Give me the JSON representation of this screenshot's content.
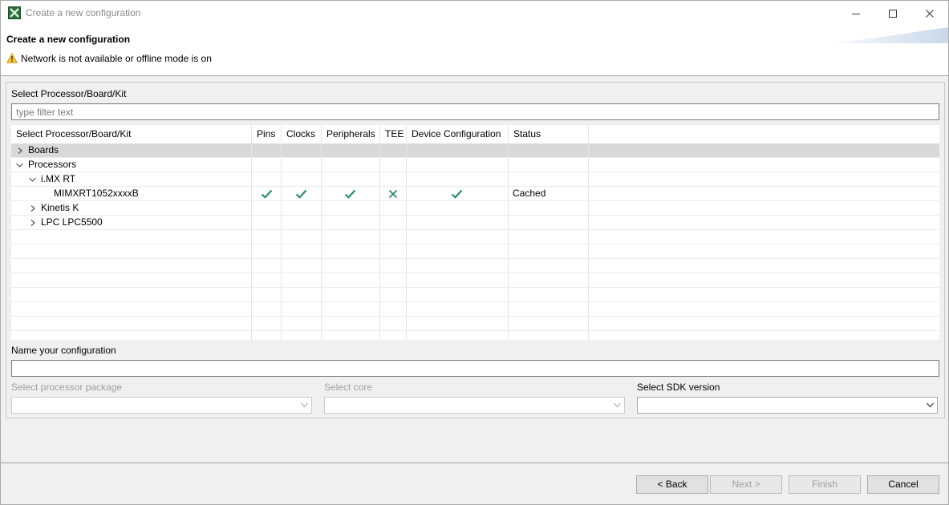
{
  "window": {
    "title": "Create a new configuration"
  },
  "header": {
    "title": "Create a new configuration",
    "message": "Network is not available or offline mode is on"
  },
  "selector": {
    "label": "Select Processor/Board/Kit",
    "filter_placeholder": "type filter text",
    "columns": [
      "Select Processor/Board/Kit",
      "Pins",
      "Clocks",
      "Peripherals",
      "TEE",
      "Device Configuration",
      "Status"
    ],
    "rows": [
      {
        "label": "Boards",
        "level": 0,
        "expander": "collapsed"
      },
      {
        "label": "Processors",
        "level": 0,
        "expander": "expanded"
      },
      {
        "label": "i.MX RT",
        "level": 1,
        "expander": "expanded"
      },
      {
        "label": "MIMXRT1052xxxxB",
        "level": 2,
        "expander": "none",
        "pins": "check",
        "clocks": "check",
        "peripherals": "check",
        "tee": "cross",
        "device_configuration": "check",
        "status": "Cached"
      },
      {
        "label": "Kinetis K",
        "level": 1,
        "expander": "collapsed"
      },
      {
        "label": "LPC LPC5500",
        "level": 1,
        "expander": "collapsed"
      }
    ]
  },
  "name_config": {
    "label": "Name your configuration",
    "value": ""
  },
  "package": {
    "label": "Select processor package",
    "value": ""
  },
  "core": {
    "label": "Select core",
    "value": ""
  },
  "sdk": {
    "label": "Select SDK version",
    "value": ""
  },
  "buttons": {
    "back": "< Back",
    "next": "Next >",
    "finish": "Finish",
    "cancel": "Cancel"
  },
  "colors": {
    "check": "#2f8a69",
    "cross": "#2f8a69",
    "selected_row": "#d9d9d9"
  }
}
